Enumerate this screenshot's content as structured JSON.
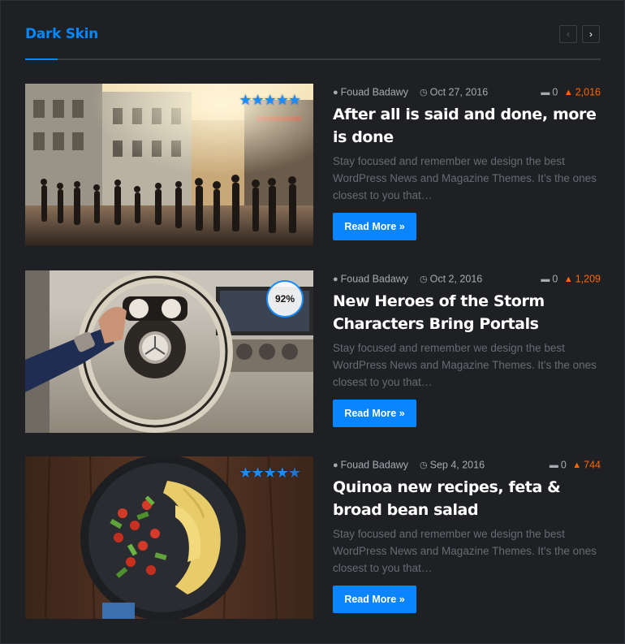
{
  "widget": {
    "title": "Dark Skin",
    "prev_icon": "chevron-left-icon",
    "next_icon": "chevron-right-icon",
    "accent_color": "#0088ff"
  },
  "posts": [
    {
      "author": "Fouad Badawy",
      "date": "Oct 27, 2016",
      "comments": "0",
      "views": "2,016",
      "title": "After all is said and done, more is done",
      "excerpt": "Stay focused and remember we design the best WordPress News and Magazine Themes. It’s the ones closest to you that…",
      "read_more": "Read More »",
      "rating_type": "stars",
      "rating_stars": 5
    },
    {
      "author": "Fouad Badawy",
      "date": "Oct 2, 2016",
      "comments": "0",
      "views": "1,209",
      "title": "New Heroes of the Storm Characters Bring Portals",
      "excerpt": "Stay focused and remember we design the best WordPress News and Magazine Themes. It’s the ones closest to you that…",
      "read_more": "Read More »",
      "rating_type": "percent",
      "rating_percent": "92%"
    },
    {
      "author": "Fouad Badawy",
      "date": "Sep 4, 2016",
      "comments": "0",
      "views": "744",
      "title": "Quinoa new recipes, feta & broad bean salad",
      "excerpt": "Stay focused and remember we design the best WordPress News and Magazine Themes. It’s the ones closest to you that…",
      "read_more": "Read More »",
      "rating_type": "stars",
      "rating_stars": 4.5
    }
  ]
}
